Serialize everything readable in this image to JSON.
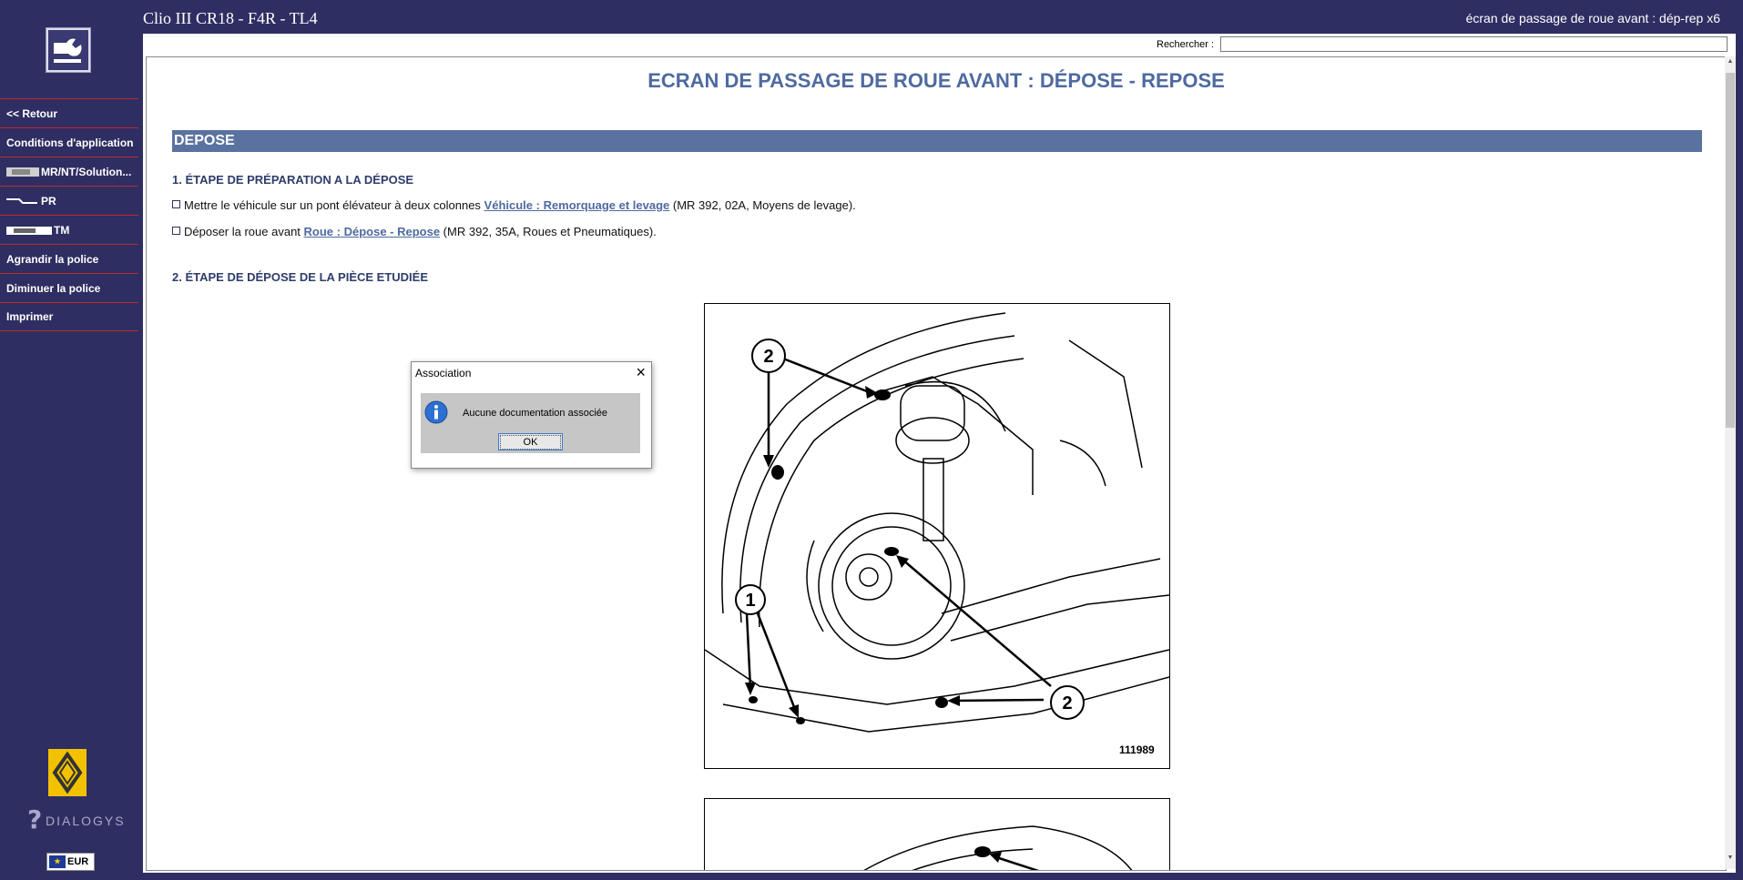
{
  "title_bar": {
    "vehicle": "Clio III CR18 - F4R - TL4",
    "document": "écran de passage de roue avant : dép-rep x6"
  },
  "sidebar": {
    "items": [
      {
        "label": "<< Retour",
        "icon": null
      },
      {
        "label": "Conditions d'application",
        "icon": null
      },
      {
        "label": "MR/NT/Solution...",
        "icon": "manual-thumbnail-icon"
      },
      {
        "label": "PR",
        "icon": "part-line-icon"
      },
      {
        "label": "TM",
        "icon": "time-thumbnail-icon"
      },
      {
        "label": "Agrandir la police",
        "icon": null
      },
      {
        "label": "Diminuer la police",
        "icon": null
      },
      {
        "label": "Imprimer",
        "icon": null
      }
    ],
    "brand_text": "DIALOGYS",
    "currency": "EUR"
  },
  "search": {
    "label": "Rechercher :",
    "value": ""
  },
  "document": {
    "title": "ECRAN DE PASSAGE DE ROUE AVANT : DÉPOSE - REPOSE",
    "section": "DEPOSE",
    "step1": "1. ÉTAPE DE PRÉPARATION A LA DÉPOSE",
    "bullets": [
      {
        "text_before": "Mettre le véhicule sur un pont élévateur à deux colonnes ",
        "link": "Véhicule : Remorquage et levage",
        "text_after": " (MR 392, 02A, Moyens de levage)."
      },
      {
        "text_before": "Déposer la roue avant ",
        "link": "Roue : Dépose - Repose",
        "text_after": " (MR 392, 35A, Roues et Pneumatiques)."
      }
    ],
    "step2": "2. ÉTAPE DE DÉPOSE DE LA PIÈCE ETUDIÉE",
    "figure": {
      "number": "111989",
      "callouts": [
        "1",
        "2",
        "2",
        "2"
      ]
    }
  },
  "dialog": {
    "title": "Association",
    "message": "Aucune documentation associée",
    "ok_label": "OK",
    "icon": "info-icon"
  },
  "colors": {
    "frame": "#2e2e63",
    "accent_blue": "#4f6aa0",
    "section_bg": "#5a72a0",
    "divider_red": "#c0282e"
  }
}
